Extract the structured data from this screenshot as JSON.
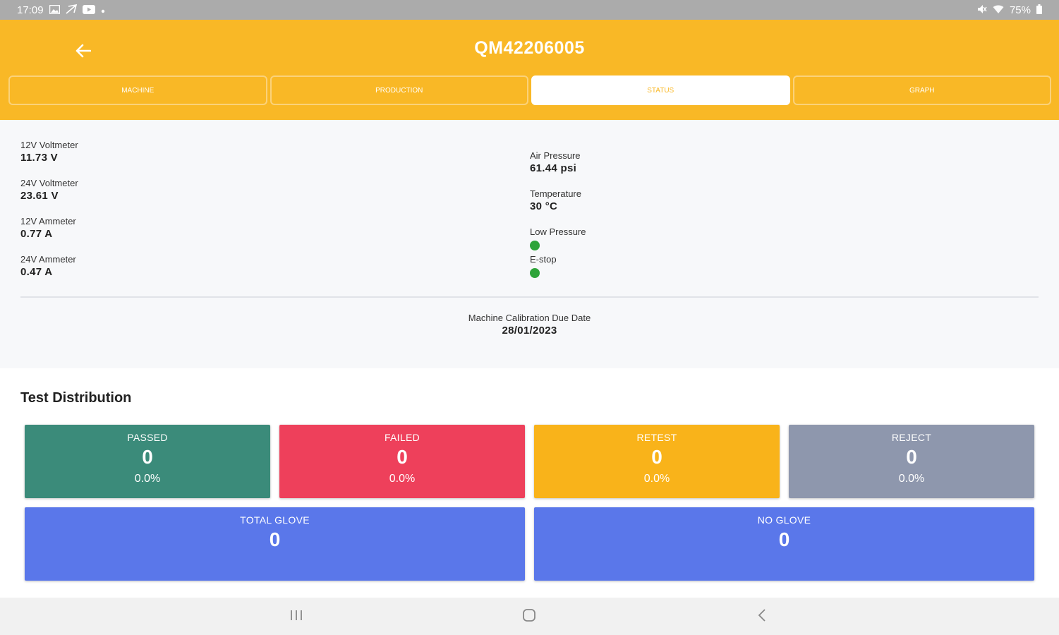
{
  "status_bar": {
    "time": "17:09",
    "battery": "75%"
  },
  "header": {
    "title": "QM42206005",
    "tabs": [
      {
        "label": "MACHINE",
        "active": false
      },
      {
        "label": "PRODUCTION",
        "active": false
      },
      {
        "label": "STATUS",
        "active": true
      },
      {
        "label": "GRAPH",
        "active": false
      }
    ],
    "accent_color": "#f9b826"
  },
  "readings_left": [
    {
      "label": "12V Voltmeter",
      "value": "11.73 V"
    },
    {
      "label": "24V Voltmeter",
      "value": "23.61 V"
    },
    {
      "label": "12V Ammeter",
      "value": "0.77 A"
    },
    {
      "label": "24V Ammeter",
      "value": "0.47 A"
    }
  ],
  "readings_right": [
    {
      "label": "Air Pressure",
      "value": "61.44 psi"
    },
    {
      "label": "Temperature",
      "value": "30 °C"
    }
  ],
  "indicators": [
    {
      "label": "Low Pressure",
      "color": "#2ea43a"
    },
    {
      "label": "E-stop",
      "color": "#2ea43a"
    }
  ],
  "calibration": {
    "label": "Machine Calibration Due Date",
    "date": "28/01/2023"
  },
  "distribution": {
    "title": "Test Distribution",
    "cards": {
      "passed": {
        "label": "PASSED",
        "value": "0",
        "percent": "0.0%",
        "color": "#3b8b7a"
      },
      "failed": {
        "label": "FAILED",
        "value": "0",
        "percent": "0.0%",
        "color": "#ee405b"
      },
      "retest": {
        "label": "RETEST",
        "value": "0",
        "percent": "0.0%",
        "color": "#f9b31a"
      },
      "reject": {
        "label": "REJECT",
        "value": "0",
        "percent": "0.0%",
        "color": "#8e97ad"
      },
      "total": {
        "label": "TOTAL GLOVE",
        "value": "0",
        "color": "#5a77ea"
      },
      "noglove": {
        "label": "NO GLOVE",
        "value": "0",
        "color": "#5a77ea"
      }
    }
  },
  "icons": {
    "back": "back-arrow-icon",
    "nav_recents": "recents-icon",
    "nav_home": "home-icon",
    "nav_back": "nav-back-icon"
  }
}
